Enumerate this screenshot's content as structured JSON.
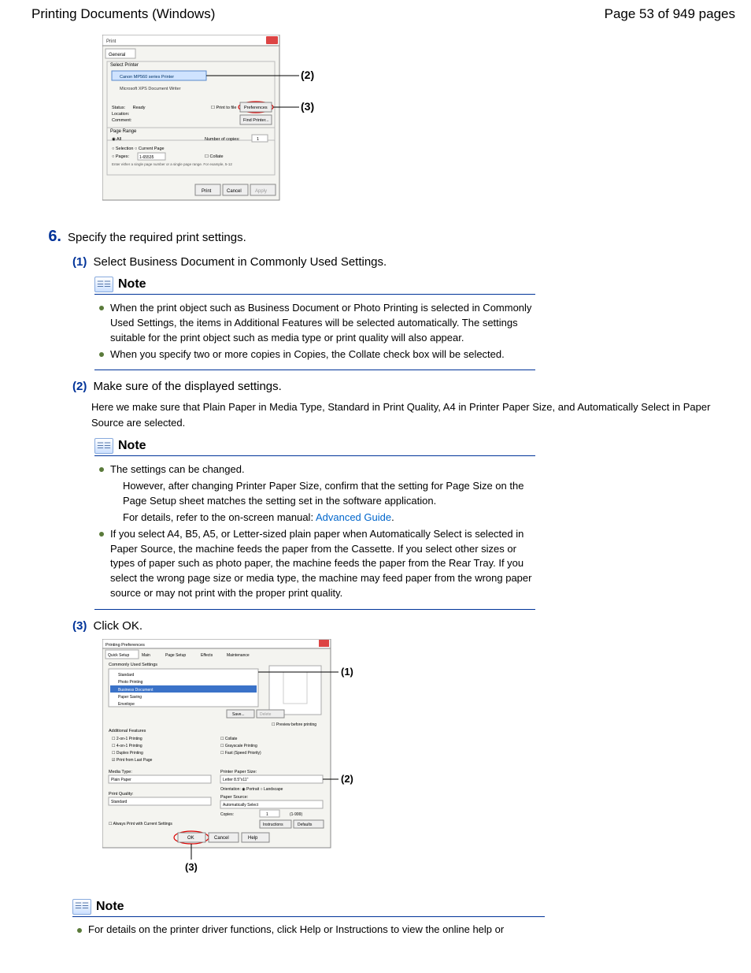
{
  "header": {
    "title": "Printing Documents (Windows)",
    "page_indicator": "Page 53 of 949 pages"
  },
  "callouts": {
    "c2": "(2)",
    "c3": "(3)",
    "d1": "(1)",
    "d2": "(2)",
    "d3": "(3)"
  },
  "step6": {
    "num": "6.",
    "text": "Specify the required print settings."
  },
  "sub1": {
    "num": "(1)",
    "text": "Select Business Document in Commonly Used Settings."
  },
  "note1": {
    "title": "Note",
    "b1": "When the print object such as Business Document or Photo Printing is selected in Commonly Used Settings, the items in Additional Features will be selected automatically. The settings suitable for the print object such as media type or print quality will also appear.",
    "b2": "When you specify two or more copies in Copies, the Collate check box will be selected."
  },
  "sub2": {
    "num": "(2)",
    "text": "Make sure of the displayed settings.",
    "desc": "Here we make sure that Plain Paper in Media Type, Standard in Print Quality, A4 in Printer Paper Size, and Automatically Select in Paper Source are selected."
  },
  "note2": {
    "title": "Note",
    "b1": "The settings can be changed.",
    "b1a": "However, after changing Printer Paper Size, confirm that the setting for Page Size on the Page Setup sheet matches the setting set in the software application.",
    "b1b_pre": "For details, refer to the on-screen manual: ",
    "b1b_link": "Advanced Guide",
    "b1b_post": ".",
    "b2": "If you select A4, B5, A5, or Letter-sized plain paper when Automatically Select is selected in Paper Source, the machine feeds the paper from the Cassette. If you select other sizes or types of paper such as photo paper, the machine feeds the paper from the Rear Tray. If you select the wrong page size or media type, the machine may feed paper from the wrong paper source or may not print with the proper print quality."
  },
  "sub3": {
    "num": "(3)",
    "text": "Click OK."
  },
  "note3": {
    "title": "Note",
    "b1": "For details on the printer driver functions, click Help or Instructions to view the online help or"
  },
  "dialog1": {
    "title": "Print",
    "tab": "General",
    "select_printer": "Select Printer",
    "printer1": "Canon MP560 series Printer",
    "printer2": "Microsoft XPS Document Writer",
    "status_label": "Status:",
    "status_value": "Ready",
    "location_label": "Location:",
    "comment_label": "Comment:",
    "print_to_file": "Print to file",
    "preferences": "Preferences",
    "find_printer": "Find Printer...",
    "page_range": "Page Range",
    "all": "All",
    "selection": "Selection",
    "current_page": "Current Page",
    "pages": "Pages:",
    "pages_val": "1-65535",
    "hint": "Enter either a single page number or a single page range. For example, 5-12",
    "copies_label": "Number of copies:",
    "copies_val": "1",
    "collate": "Collate",
    "print_btn": "Print",
    "cancel_btn": "Cancel",
    "apply_btn": "Apply"
  },
  "dialog2": {
    "title": "Printing Preferences",
    "tabs": [
      "Quick Setup",
      "Main",
      "Page Setup",
      "Effects",
      "Maintenance"
    ],
    "commonly_used": "Commonly Used Settings",
    "items": [
      "Standard",
      "Photo Printing",
      "Business Document",
      "Paper Saving",
      "Envelope"
    ],
    "save_btn": "Save...",
    "delete_btn": "Delete",
    "preview": "Preview before printing",
    "additional": "Additional Features",
    "af_items": [
      "2-on-1 Printing",
      "4-on-1 Printing",
      "Duplex Printing",
      "Print from Last Page"
    ],
    "af_right": [
      "Collate",
      "Grayscale Printing",
      "Fast (Speed Priority)"
    ],
    "media_type": "Media Type:",
    "media_val": "Plain Paper",
    "paper_size": "Printer Paper Size:",
    "paper_val": "Letter 8.5\"x11\"",
    "orientation": "Orientation:",
    "portrait": "Portrait",
    "landscape": "Landscape",
    "quality": "Print Quality:",
    "quality_val": "Standard",
    "source": "Paper Source:",
    "source_val": "Automatically Select",
    "copies": "Copies:",
    "copies_val": "1",
    "copies_range": "(1-999)",
    "always": "Always Print with Current Settings",
    "instructions": "Instructions",
    "defaults": "Defaults",
    "ok": "OK",
    "cancel": "Cancel",
    "help": "Help"
  }
}
